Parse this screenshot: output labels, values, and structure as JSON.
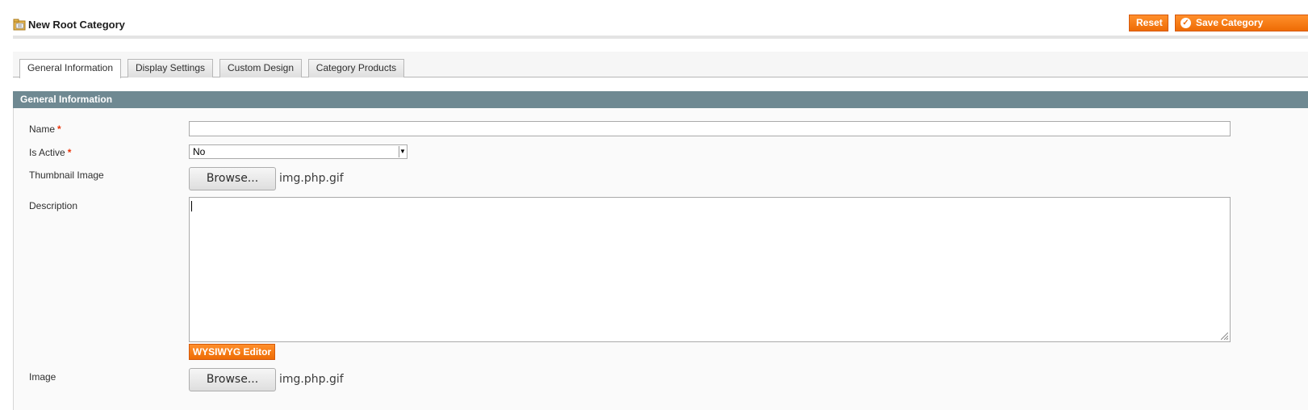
{
  "header": {
    "title": "New Root Category",
    "reset_label": "Reset",
    "save_label": "Save Category"
  },
  "tabs": [
    {
      "label": "General Information",
      "active": true
    },
    {
      "label": "Display Settings",
      "active": false
    },
    {
      "label": "Custom Design",
      "active": false
    },
    {
      "label": "Category Products",
      "active": false
    }
  ],
  "section": {
    "title": "General Information"
  },
  "fields": {
    "name": {
      "label": "Name",
      "required": "*",
      "value": ""
    },
    "is_active": {
      "label": "Is Active",
      "required": "*",
      "value": "No"
    },
    "thumbnail": {
      "label": "Thumbnail Image",
      "button": "Browse...",
      "filename": "img.php.gif"
    },
    "description": {
      "label": "Description",
      "value": "",
      "editor_button": "WYSIWYG Editor"
    },
    "image": {
      "label": "Image",
      "button": "Browse...",
      "filename": "img.php.gif"
    }
  },
  "colors": {
    "accent": "#ee6c05",
    "section_header": "#6f8992",
    "required": "#eb340a"
  },
  "icons": {
    "header": "folder-icon",
    "save": "check-circle-icon"
  }
}
